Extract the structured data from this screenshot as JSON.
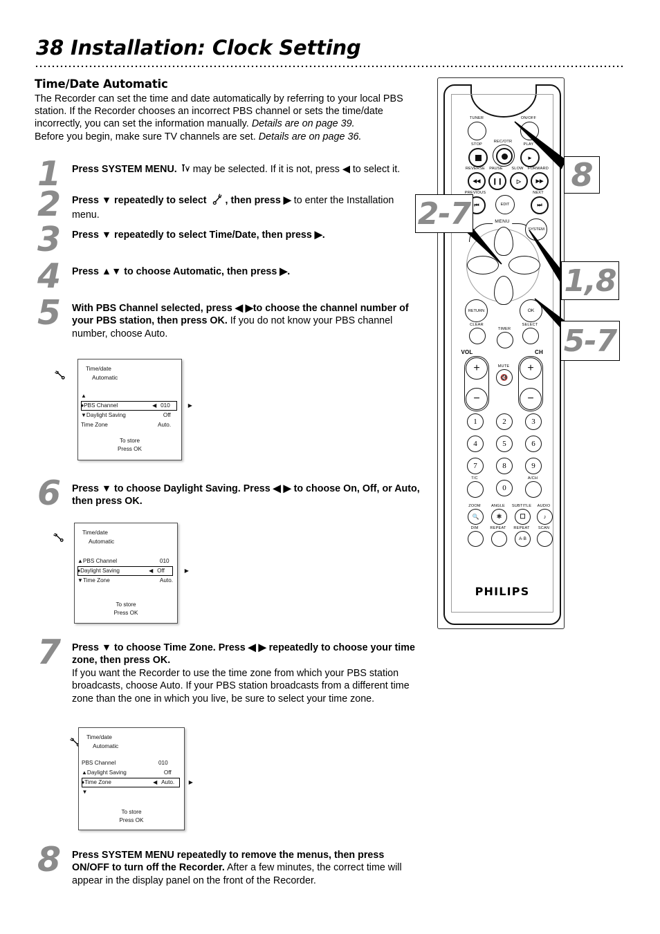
{
  "header": {
    "page_number": "38",
    "title": "Installation: Clock Setting"
  },
  "section": {
    "title": "Time/Date Automatic",
    "paragraph_1": "The Recorder can set the time and date automatically by referring to your local PBS station. If the Recorder chooses an incorrect PBS channel or sets the time/date incorrectly, you can set the information manually. ",
    "paragraph_1_italic": "Details are on page 39.",
    "paragraph_2": "Before you begin, make sure TV channels are set.  ",
    "paragraph_2_italic": "Details are on page 36."
  },
  "steps": [
    {
      "number": "1",
      "bold_a": "Press SYSTEM MENU.",
      "icon": "tv-antenna-icon",
      "rest": " may be selected. If it is not, press ◀ to select it."
    },
    {
      "number": "2",
      "bold_a": "Press ▼ repeatedly to select",
      "icon": "wrench-icon",
      "bold_b": ", then press ▶",
      "rest": " to enter the Installation menu."
    },
    {
      "number": "3",
      "bold_a": "Press ▼ repeatedly to select Time/Date, then press ▶."
    },
    {
      "number": "4",
      "bold_a": "Press ▲▼ to choose Automatic, then press ▶."
    },
    {
      "number": "5",
      "bold_a": "With PBS Channel selected, press ◀ ▶to choose the channel number of your PBS station, then press OK.",
      "rest": " If you do not know your PBS channel number, choose Auto."
    },
    {
      "number": "6",
      "bold_a": "Press ▼ to choose Daylight Saving. Press ◀ ▶ to choose On, Off, or Auto, then press OK."
    },
    {
      "number": "7",
      "bold_a": "Press ▼ to choose Time Zone. Press ◀ ▶ repeatedly to choose your time zone, then press OK.",
      "rest": "If you want the Recorder to use the time zone from which your PBS station broadcasts, choose Auto. If your PBS station broadcasts from a different time zone than the one in which you live, be sure to select your time zone."
    },
    {
      "number": "8",
      "bold_a": "Press SYSTEM MENU repeatedly to remove the menus, then press ON/OFF to turn off the Recorder.",
      "rest": " After a few minutes, the correct time will appear in the display panel on the front of the Recorder."
    }
  ],
  "osd_screens": [
    {
      "id": "osd-pbs-channel",
      "title_line1": "Time/date",
      "title_line2": "Automatic",
      "rows": [
        {
          "marker": "▲",
          "label": "",
          "value": "",
          "selected": false,
          "spacer": true
        },
        {
          "marker": "♦",
          "label": "PBS Channel",
          "value": "010",
          "selected": true,
          "arrows": true
        },
        {
          "marker": "▼",
          "label": "Daylight Saving",
          "value": "Off",
          "selected": false
        },
        {
          "marker": "",
          "label": "Time Zone",
          "value": "Auto.",
          "selected": false
        }
      ],
      "footer_line1": "To store",
      "footer_line2": "Press OK"
    },
    {
      "id": "osd-daylight-saving",
      "title_line1": "Time/date",
      "title_line2": "Automatic",
      "rows": [
        {
          "marker": "▲",
          "label": "PBS Channel",
          "value": "010",
          "selected": false
        },
        {
          "marker": "♦",
          "label": "Daylight Saving",
          "value": "Off",
          "selected": true,
          "arrows": true
        },
        {
          "marker": "▼",
          "label": "Time Zone",
          "value": "Auto.",
          "selected": false
        }
      ],
      "footer_line1": "To store",
      "footer_line2": "Press OK"
    },
    {
      "id": "osd-time-zone",
      "title_line1": "Time/date",
      "title_line2": "Automatic",
      "rows": [
        {
          "marker": "",
          "label": "PBS Channel",
          "value": "010",
          "selected": false
        },
        {
          "marker": "▲",
          "label": "Daylight Saving",
          "value": "Off",
          "selected": false
        },
        {
          "marker": "♦",
          "label": "Time Zone",
          "value": "Auto.",
          "selected": true,
          "arrows": true
        },
        {
          "marker": "▼",
          "label": "",
          "value": "",
          "selected": false,
          "spacer": true
        }
      ],
      "footer_line1": "To store",
      "footer_line2": "Press OK"
    }
  ],
  "remote": {
    "brand": "PHILIPS",
    "menu_label": "MENU",
    "captions": {
      "tuner": "TUNER",
      "onoff": "ON/OFF",
      "stop": "STOP",
      "recotr": "REC/OTR",
      "play": "PLAY",
      "reverse": "REVERSE",
      "pause": "PAUSE",
      "slow": "SLOW",
      "forward": "FORWARD",
      "previous": "PREVIOUS",
      "next": "NEXT",
      "edit": "EDIT",
      "system": "SYSTEM",
      "return": "RETURN",
      "ok": "OK",
      "clear": "CLEAR",
      "timer": "TIMER",
      "select": "SELECT",
      "vol": "VOL",
      "ch": "CH",
      "mute": "MUTE",
      "tc": "T/C",
      "ach": "A/CH",
      "zoom": "ZOOM",
      "angle": "ANGLE",
      "subtitle": "SUBTITLE",
      "audio": "AUDIO",
      "dim": "DIM",
      "repeat1": "REPEAT",
      "repeat2": "REPEAT",
      "scan": "SCAN",
      "repeat_ab": "A·B"
    },
    "numpad": [
      "1",
      "2",
      "3",
      "4",
      "5",
      "6",
      "7",
      "8",
      "9",
      "0"
    ],
    "vol_plus": "+",
    "vol_minus": "−",
    "ch_plus": "+",
    "ch_minus": "−"
  },
  "callouts": [
    {
      "id": "callout-8",
      "label": "8"
    },
    {
      "id": "callout-2-7",
      "label": "2-7"
    },
    {
      "id": "callout-1-8",
      "label": "1,8"
    },
    {
      "id": "callout-5-7",
      "label": "5-7"
    }
  ],
  "colors": {
    "step_number_gray": "#8b8b8b",
    "text_black": "#000000",
    "osd_border": "#4a4a4a"
  }
}
